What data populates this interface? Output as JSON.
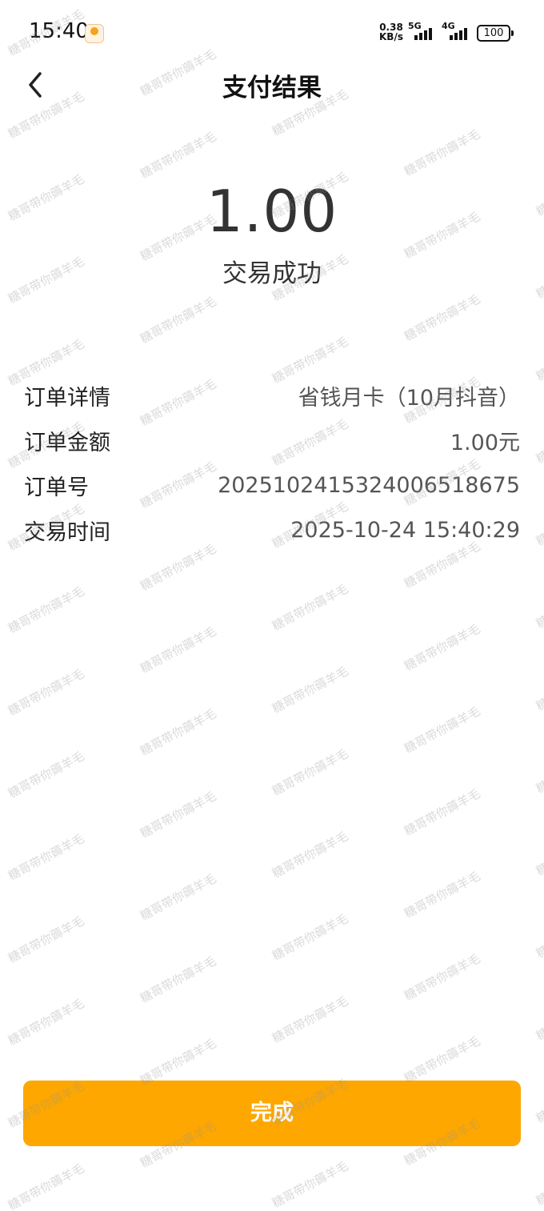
{
  "status_bar": {
    "time": "15:40",
    "net_speed_value": "0.38",
    "net_speed_unit": "KB/s",
    "signal1_label": "5G",
    "signal2_label": "4G",
    "battery": "100"
  },
  "nav": {
    "title": "支付结果",
    "back_icon": "chevron-left-icon"
  },
  "result": {
    "amount": "1.00",
    "status": "交易成功"
  },
  "details": [
    {
      "label": "订单详情",
      "value": "省钱月卡（10月抖音）"
    },
    {
      "label": "订单金额",
      "value": "1.00元"
    },
    {
      "label": "订单号",
      "value": "20251024153240065186​75"
    },
    {
      "label": "交易时间",
      "value": "2025-10-24 15:40:29"
    }
  ],
  "done_button": "完成",
  "watermark": "糖哥带你薅羊毛",
  "colors": {
    "accent": "#fda700",
    "text": "#222222"
  }
}
